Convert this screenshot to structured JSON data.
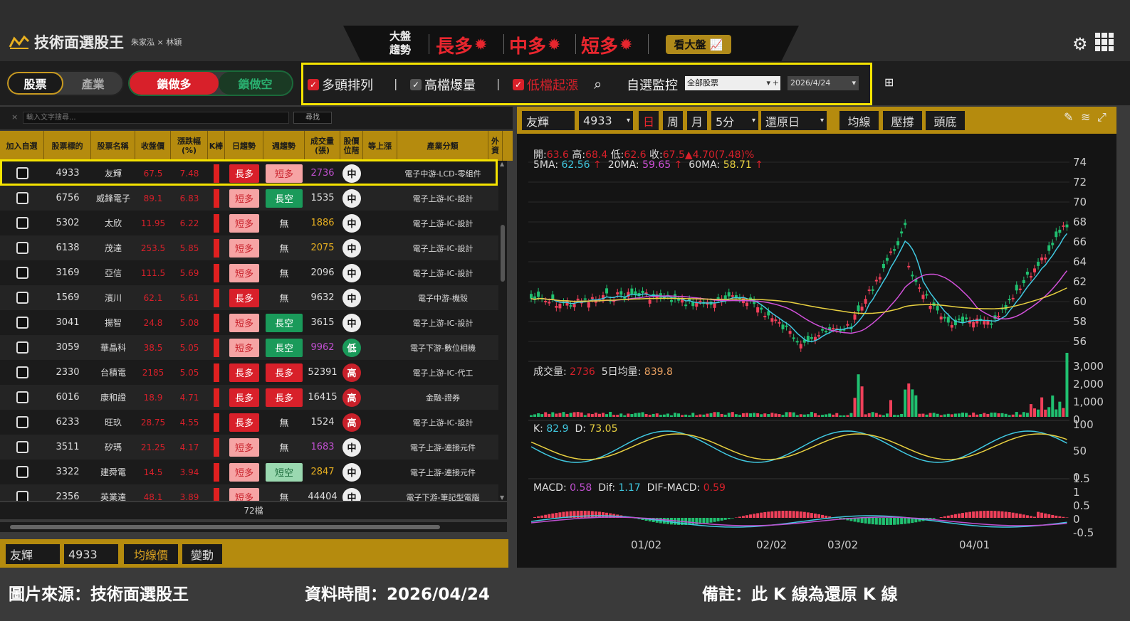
{
  "app": {
    "title": "技術面選股王",
    "authors": "朱家泓 × 林穎"
  },
  "trend": {
    "label1": "大盤",
    "label2": "趨勢",
    "items": [
      "長多",
      "中多",
      "短多"
    ],
    "market_btn": "看大盤"
  },
  "tabs": {
    "stock": "股票",
    "industry": "產業",
    "lock_long": "鎖做多",
    "lock_short": "鎖做空"
  },
  "filters": {
    "f1": "多頭排列",
    "f2": "高檔爆量",
    "f3": "低檔起漲",
    "watch": "自選監控",
    "watch_value": "全部股票",
    "date": "2026/4/24"
  },
  "search": {
    "placeholder": "輸入文字搜尋...",
    "button": "尋找"
  },
  "table": {
    "headers": [
      "加入自選",
      "股票標的",
      "股票名稱",
      "收盤價",
      "漲跌幅(%)",
      "K棒",
      "日趨勢",
      "週趨勢",
      "成交量(張)",
      "股價位階",
      "等上漲",
      "產業分類",
      "外資"
    ],
    "rows": [
      {
        "code": "4933",
        "name": "友輝",
        "close": "67.5",
        "chg": "7.48",
        "daily": "長多",
        "dtype": "long",
        "weekly": "短多",
        "wtype": "short",
        "vol": "2736",
        "vcolor": "#c050d0",
        "level": "中",
        "ltype": "mid",
        "ind": "電子中游-LCD-零組件"
      },
      {
        "code": "6756",
        "name": "威鋒電子",
        "close": "89.1",
        "chg": "6.83",
        "daily": "短多",
        "dtype": "short",
        "weekly": "長空",
        "wtype": "lkong",
        "vol": "1535",
        "vcolor": "#ddd",
        "level": "中",
        "ltype": "mid",
        "ind": "電子上游-IC-設計"
      },
      {
        "code": "5302",
        "name": "太欣",
        "close": "11.95",
        "chg": "6.22",
        "daily": "短多",
        "dtype": "short",
        "weekly": "無",
        "wtype": "none",
        "vol": "1886",
        "vcolor": "#e8b020",
        "level": "中",
        "ltype": "mid",
        "ind": "電子上游-IC-設計"
      },
      {
        "code": "6138",
        "name": "茂達",
        "close": "253.5",
        "chg": "5.85",
        "daily": "短多",
        "dtype": "short",
        "weekly": "無",
        "wtype": "none",
        "vol": "2075",
        "vcolor": "#e8b020",
        "level": "中",
        "ltype": "mid",
        "ind": "電子上游-IC-設計"
      },
      {
        "code": "3169",
        "name": "亞信",
        "close": "111.5",
        "chg": "5.69",
        "daily": "短多",
        "dtype": "short",
        "weekly": "無",
        "wtype": "none",
        "vol": "2096",
        "vcolor": "#ddd",
        "level": "中",
        "ltype": "mid",
        "ind": "電子上游-IC-設計"
      },
      {
        "code": "1569",
        "name": "濱川",
        "close": "62.1",
        "chg": "5.61",
        "daily": "長多",
        "dtype": "long",
        "weekly": "無",
        "wtype": "none",
        "vol": "9632",
        "vcolor": "#ddd",
        "level": "中",
        "ltype": "mid",
        "ind": "電子中游-機殼"
      },
      {
        "code": "3041",
        "name": "揚智",
        "close": "24.8",
        "chg": "5.08",
        "daily": "短多",
        "dtype": "short",
        "weekly": "長空",
        "wtype": "lkong",
        "vol": "3615",
        "vcolor": "#ddd",
        "level": "中",
        "ltype": "mid",
        "ind": "電子上游-IC-設計"
      },
      {
        "code": "3059",
        "name": "華晶科",
        "close": "38.5",
        "chg": "5.05",
        "daily": "短多",
        "dtype": "short",
        "weekly": "長空",
        "wtype": "lkong",
        "vol": "9962",
        "vcolor": "#c050d0",
        "level": "低",
        "ltype": "low",
        "ind": "電子下游-數位相機"
      },
      {
        "code": "2330",
        "name": "台積電",
        "close": "2185",
        "chg": "5.05",
        "daily": "長多",
        "dtype": "long",
        "weekly": "長多",
        "wtype": "long",
        "vol": "52391",
        "vcolor": "#ddd",
        "level": "高",
        "ltype": "high",
        "ind": "電子上游-IC-代工"
      },
      {
        "code": "6016",
        "name": "康和證",
        "close": "18.9",
        "chg": "4.71",
        "daily": "長多",
        "dtype": "long",
        "weekly": "長多",
        "wtype": "long",
        "vol": "16415",
        "vcolor": "#ddd",
        "level": "高",
        "ltype": "high",
        "ind": "金融-證券"
      },
      {
        "code": "6233",
        "name": "旺玖",
        "close": "28.75",
        "chg": "4.55",
        "daily": "長多",
        "dtype": "long",
        "weekly": "無",
        "wtype": "none",
        "vol": "1524",
        "vcolor": "#ddd",
        "level": "高",
        "ltype": "high",
        "ind": "電子上游-IC-設計"
      },
      {
        "code": "3511",
        "name": "矽瑪",
        "close": "21.25",
        "chg": "4.17",
        "daily": "短多",
        "dtype": "short",
        "weekly": "無",
        "wtype": "none",
        "vol": "1683",
        "vcolor": "#c050d0",
        "level": "中",
        "ltype": "mid",
        "ind": "電子上游-連接元件"
      },
      {
        "code": "3322",
        "name": "建舜電",
        "close": "14.5",
        "chg": "3.94",
        "daily": "短多",
        "dtype": "short",
        "weekly": "短空",
        "wtype": "skong",
        "vol": "2847",
        "vcolor": "#e8b020",
        "level": "中",
        "ltype": "mid",
        "ind": "電子上游-連接元件"
      },
      {
        "code": "2356",
        "name": "英業達",
        "close": "48.1",
        "chg": "3.89",
        "daily": "短多",
        "dtype": "short",
        "weekly": "無",
        "wtype": "none",
        "vol": "44404",
        "vcolor": "#ddd",
        "level": "中",
        "ltype": "mid",
        "ind": "電子下游-筆記型電腦"
      }
    ],
    "count": "72檔"
  },
  "bottom_left": {
    "name": "友輝",
    "code": "4933",
    "ma_price": "均線價",
    "change": "變動"
  },
  "chart_toolbar": {
    "name": "友輝",
    "code": "4933",
    "day": "日",
    "week": "周",
    "month": "月",
    "min5": "5分",
    "restore": "還原日",
    "ma": "均線",
    "pressure": "壓撐",
    "top": "頭底"
  },
  "chart_info": {
    "open_label": "開:",
    "open": "63.6",
    "high_label": "高:",
    "high": "68.4",
    "low_label": "低:",
    "low": "62.6",
    "close_label": "收:",
    "close": "67.5▲4.70(7.48)%",
    "ma5_label": "5MA:",
    "ma5": "62.56",
    "ma20_label": "20MA:",
    "ma20": "59.65",
    "ma60_label": "60MA:",
    "ma60": "58.71",
    "arrow": "↑",
    "vol_label": "成交量:",
    "vol": "2736",
    "vol5_label": "5日均量:",
    "vol5": "839.8",
    "k_label": "K:",
    "k": "82.9",
    "d_label": "D:",
    "d": "73.05",
    "macd_label": "MACD:",
    "macd": "0.58",
    "dif_label": "Dif:",
    "dif": "1.17",
    "difmacd_label": "DIF-MACD:",
    "difmacd": "0.59"
  },
  "chart_axes": {
    "price_ticks": [
      "74",
      "72",
      "70",
      "68",
      "66",
      "64",
      "62",
      "60",
      "58",
      "56"
    ],
    "vol_ticks": [
      "3,000",
      "2,000",
      "1,000",
      "0"
    ],
    "kd_ticks": [
      "100",
      "50",
      "0"
    ],
    "macd_ticks": [
      "1.5",
      "1",
      "0.5",
      "0",
      "-0.5"
    ],
    "dates": [
      "01/02",
      "02/02",
      "03/02",
      "04/01"
    ]
  },
  "footer": {
    "source": "圖片來源：技術面選股王",
    "time": "資料時間：2026/04/24",
    "note": "備註：此 K 線為還原 K 線"
  },
  "colors": {
    "gold": "#b58b0e",
    "red": "#d8202a",
    "green": "#1a9a5a",
    "highlight": "#f5e400"
  }
}
